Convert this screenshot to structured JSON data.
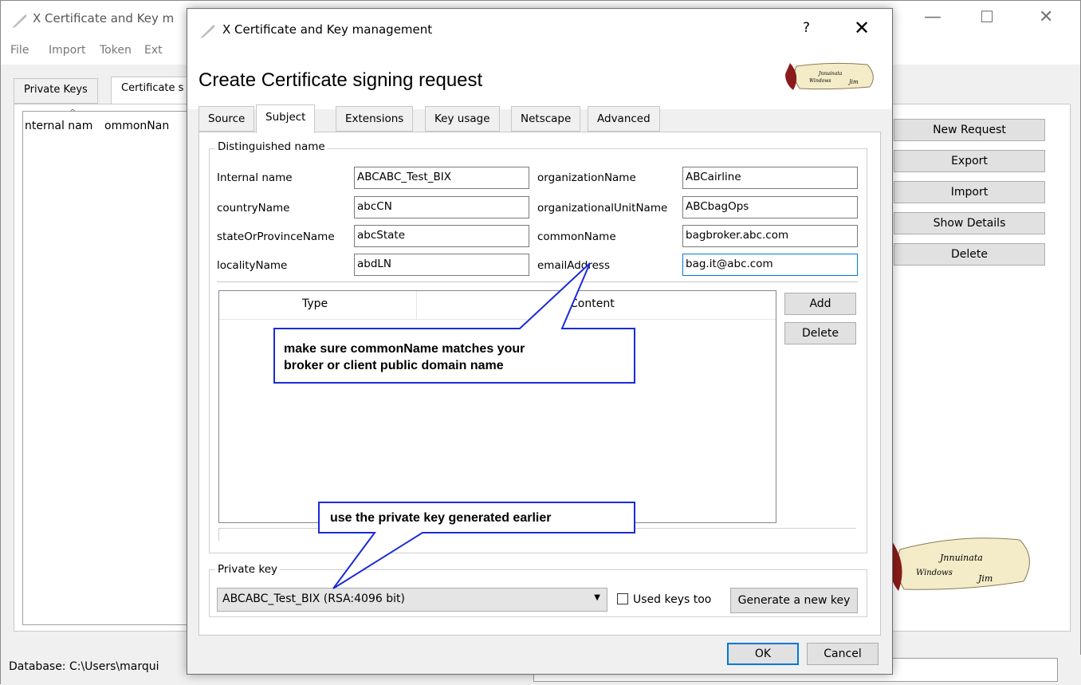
{
  "main_window": {
    "title": "X Certificate and Key m",
    "menu": [
      "File",
      "Import",
      "Token",
      "Ext"
    ],
    "tabs": [
      "Private Keys",
      "Certificate s"
    ],
    "list_columns": [
      "nternal nam",
      "ommonNan"
    ],
    "buttons": [
      "New Request",
      "Export",
      "Import",
      "Show Details",
      "Delete"
    ],
    "status": "Database: C:\\Users\\marqui"
  },
  "dialog": {
    "title": "X Certificate and Key management",
    "help": "?",
    "close": "✕",
    "heading": "Create Certificate signing request",
    "tabs": [
      "Source",
      "Subject",
      "Extensions",
      "Key usage",
      "Netscape",
      "Advanced"
    ],
    "active_tab": "Subject",
    "dn_group": "Distinguished name",
    "fields": {
      "internal_name": {
        "label": "Internal name",
        "value": "ABCABC_Test_BIX"
      },
      "country": {
        "label": "countryName",
        "value": "abcCN"
      },
      "state": {
        "label": "stateOrProvinceName",
        "value": "abcState"
      },
      "locality": {
        "label": "localityName",
        "value": "abdLN"
      },
      "org": {
        "label": "organizationName",
        "value": "ABCairline"
      },
      "org_unit": {
        "label": "organizationalUnitName",
        "value": "ABCbagOps"
      },
      "common": {
        "label": "commonName",
        "value": "bagbroker.abc.com"
      },
      "email": {
        "label": "emailAddress",
        "value": "bag.it@abc.com"
      }
    },
    "table_headers": [
      "Type",
      "Content"
    ],
    "add_button": "Add",
    "delete_button": "Delete",
    "private_key_group": "Private key",
    "private_key_value": "ABCABC_Test_BIX (RSA:4096 bit)",
    "used_keys_label": "Used keys too",
    "generate_button": "Generate a new key",
    "ok_button": "OK",
    "cancel_button": "Cancel"
  },
  "callouts": {
    "common_name": [
      "make sure commonName matches your",
      "broker or client public domain name"
    ],
    "private_key": "use the private key generated earlier"
  },
  "colors": {
    "callout_fill": "#ffffff",
    "callout_border": "#1a2bd8",
    "focus": "#0078d7"
  }
}
